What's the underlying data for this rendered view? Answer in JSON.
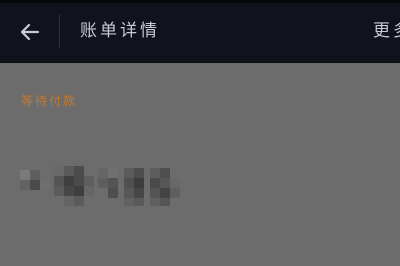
{
  "header": {
    "title": "账单详情",
    "more_label": "更多",
    "back_icon": "arrow-left-icon"
  },
  "bill": {
    "status": "等待付款"
  },
  "colors": {
    "header_bg": "#10131c",
    "page_bg": "#6c6c6c",
    "status_color": "#c07a33",
    "title_color": "#c7cad3"
  }
}
